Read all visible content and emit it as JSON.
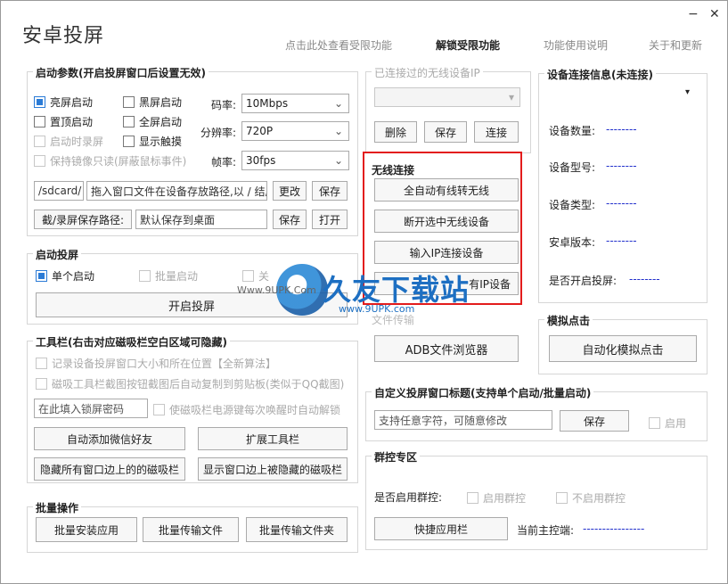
{
  "window": {
    "title": "安卓投屏",
    "minimize_label": "−",
    "close_label": "✕"
  },
  "nav": {
    "view_limited": "点击此处查看受限功能",
    "unlock": "解锁受限功能",
    "guide": "功能使用说明",
    "about": "关于和更新"
  },
  "launch_params": {
    "title": "启动参数(开启投屏窗口后设置无效)",
    "bright_start": "亮屏启动",
    "black_start": "黑屏启动",
    "top_start": "置顶启动",
    "full_start": "全屏启动",
    "record_start": "启动时录屏",
    "show_touch": "显示触摸",
    "readonly": "保持镜像只读(屏蔽鼠标事件)",
    "bitrate_label": "码率:",
    "bitrate_value": "10Mbps",
    "resolution_label": "分辨率:",
    "resolution_value": "720P",
    "fps_label": "帧率:",
    "fps_value": "30fps",
    "path_prefix": "/sdcard/",
    "path_hint": "拖入窗口文件在设备存放路径,以 / 结尾",
    "modify_btn": "更改",
    "save_btn": "保存",
    "screenshot_path_label": "截/录屏保存路径:",
    "screenshot_path_value": "默认保存到桌面",
    "save_btn2": "保存",
    "open_btn": "打开"
  },
  "launch": {
    "title": "启动投屏",
    "single": "单个启动",
    "batch": "批量启动",
    "third": "关",
    "start_btn": "开启投屏"
  },
  "toolbar": {
    "title": "工具栏(右击对应磁吸栏空白区域可隐藏)",
    "record_pos": "记录设备投屏窗口大小和所在位置【全新算法】",
    "snap_copy": "磁吸工具栏截图按钮截图后自动复制到剪贴板(类似于QQ截图)",
    "lock_pwd_placeholder": "在此填入锁屏密码",
    "auto_unlock": "使磁吸栏电源键每次唤醒时自动解锁",
    "add_wechat": "自动添加微信好友",
    "extend_toolbar": "扩展工具栏",
    "hide_bars": "隐藏所有窗口边上的的磁吸栏",
    "show_bars": "显示窗口边上被隐藏的磁吸栏"
  },
  "batch": {
    "title": "批量操作",
    "install": "批量安装应用",
    "transfer_file": "批量传输文件",
    "transfer_folder": "批量传输文件夹"
  },
  "connected_ip": {
    "title": "已连接过的无线设备IP",
    "delete": "删除",
    "save": "保存",
    "connect": "连接"
  },
  "wireless": {
    "title": "无线连接",
    "auto_wireless": "全自动有线转无线",
    "disconnect": "断开选中无线设备",
    "input_ip": "输入IP连接设备",
    "all_ip": "有IP设备"
  },
  "file_transfer": {
    "title": "文件传输",
    "adb_browser": "ADB文件浏览器"
  },
  "device_info": {
    "title": "设备连接信息(未连接)",
    "count_label": "设备数量:",
    "count_value": "--------",
    "model_label": "设备型号:",
    "model_value": "--------",
    "type_label": "设备类型:",
    "type_value": "--------",
    "version_label": "安卓版本:",
    "version_value": "--------",
    "casting_label": "是否开启投屏:",
    "casting_value": "--------"
  },
  "simulate": {
    "title": "模拟点击",
    "auto_click": "自动化模拟点击"
  },
  "custom_title": {
    "title": "自定义投屏窗口标题(支持单个启动/批量启动)",
    "placeholder": "支持任意字符，可随意修改",
    "save": "保存",
    "enable": "启用"
  },
  "group_control": {
    "title": "群控专区",
    "enable_label": "是否启用群控:",
    "enable": "启用群控",
    "disable": "不启用群控",
    "shortcut": "快捷应用栏",
    "master_label": "当前主控端:",
    "master_value": "----------------"
  },
  "watermark": {
    "brand": "久友下载站",
    "url_small": "Www.9UPK.Com",
    "url": "www.9UPK.com"
  },
  "icons": {
    "dropdown": "chevron-down-icon",
    "logo": "9upk-logo-icon"
  }
}
